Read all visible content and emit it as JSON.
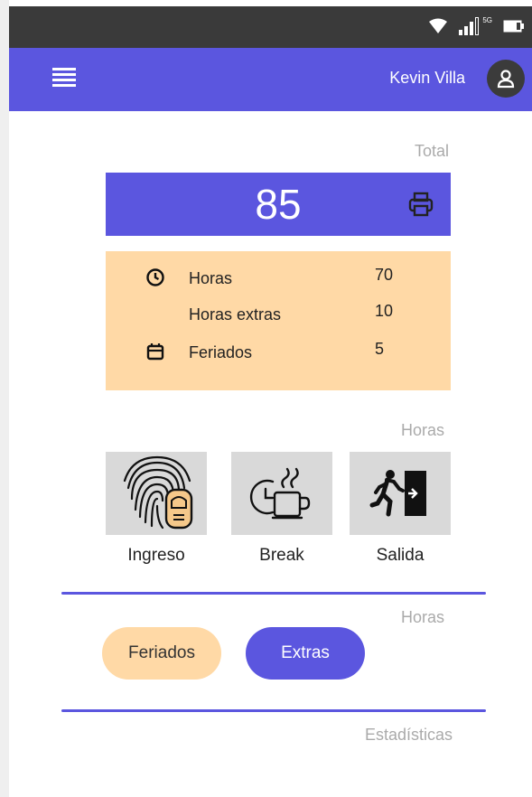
{
  "statusbar": {
    "network": "5G"
  },
  "appbar": {
    "menu_icon": "menu-icon",
    "user_name": "Kevin Villa",
    "avatar_icon": "user-icon"
  },
  "total": {
    "label": "Total",
    "value": "85",
    "print_icon": "printer-icon"
  },
  "summary": {
    "rows": [
      {
        "icon": "clock-icon",
        "label": "Horas",
        "value": "70"
      },
      {
        "icon": "",
        "label": "Horas extras",
        "value": "10"
      },
      {
        "icon": "calendar-icon",
        "label": "Feriados",
        "value": "5"
      }
    ]
  },
  "actions_section": {
    "label": "Horas"
  },
  "actions": [
    {
      "icon": "fingerprint-icon",
      "label": "Ingreso"
    },
    {
      "icon": "coffee-break-icon",
      "label": "Break"
    },
    {
      "icon": "exit-icon",
      "label": "Salida"
    }
  ],
  "filters_section": {
    "label": "Horas"
  },
  "filters": [
    {
      "label": "Feriados",
      "active": false
    },
    {
      "label": "Extras",
      "active": true
    }
  ],
  "stats_section": {
    "label": "Estadísticas"
  },
  "colors": {
    "primary": "#5b56df",
    "accent": "#ffd9a6",
    "status_bar": "#3a3a3a",
    "tile": "#d9d9d9"
  }
}
